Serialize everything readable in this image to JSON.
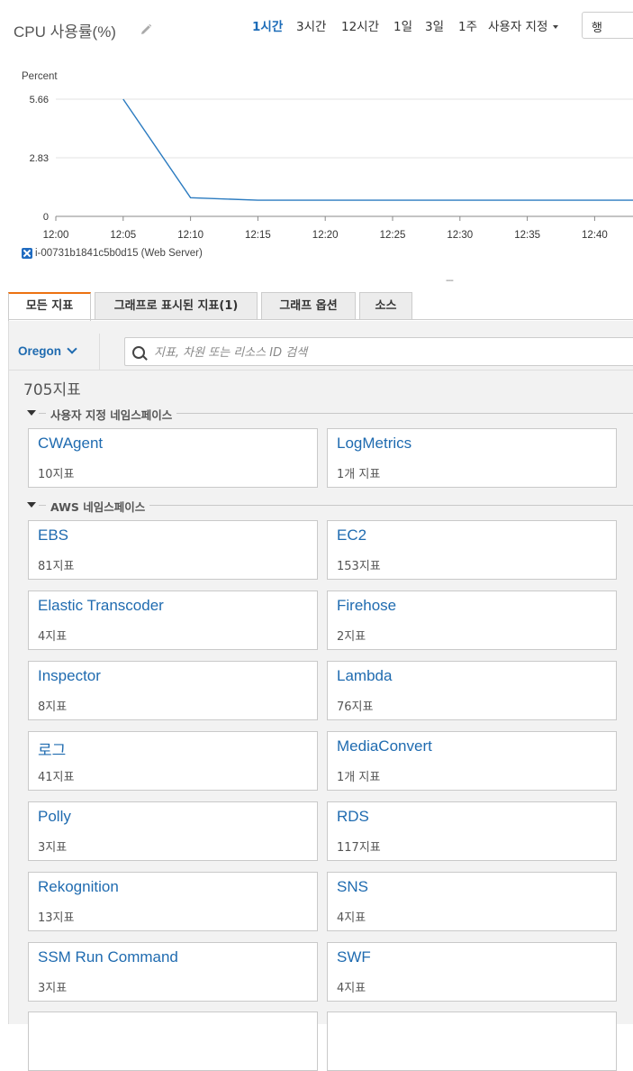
{
  "header": {
    "title": "CPU 사용률(%)",
    "ranges": [
      "1시간",
      "3시간",
      "12시간",
      "1일",
      "3일",
      "1주"
    ],
    "active_range": "1시간",
    "custom_label": "사용자 지정",
    "period_select_value": "행"
  },
  "chart_data": {
    "type": "line",
    "ylabel": "Percent",
    "y_ticks": [
      "0",
      "2.83",
      "5.66"
    ],
    "x_ticks": [
      "12:00",
      "12:05",
      "12:10",
      "12:15",
      "12:20",
      "12:25",
      "12:30",
      "12:35",
      "12:40"
    ],
    "series": [
      {
        "name": "i-00731b1841c5b0d15 (Web Server)",
        "x": [
          "12:05",
          "12:10",
          "12:15",
          "12:20",
          "12:25",
          "12:30",
          "12:35",
          "12:40",
          "12:43"
        ],
        "values": [
          5.66,
          0.9,
          0.78,
          0.78,
          0.78,
          0.78,
          0.78,
          0.78,
          0.78
        ]
      }
    ],
    "ylim": [
      0,
      5.66
    ],
    "color": "#2b7bc0"
  },
  "legend": {
    "label": "i-00731b1841c5b0d15 (Web Server)"
  },
  "tabs": [
    "모든 지표",
    "그래프로 표시된 지표(1)",
    "그래프 옵션",
    "소스"
  ],
  "browser": {
    "region": "Oregon",
    "search_placeholder": "지표, 차원 또는 리소스 ID 검색",
    "total_count": "705지표",
    "custom_namespace_header": "사용자 지정 네임스페이스",
    "aws_namespace_header": "AWS 네임스페이스",
    "custom_namespaces": [
      {
        "name": "CWAgent",
        "count": "10지표"
      },
      {
        "name": "LogMetrics",
        "count": "1개 지표"
      }
    ],
    "aws_namespaces": [
      {
        "name": "EBS",
        "count": "81지표"
      },
      {
        "name": "EC2",
        "count": "153지표"
      },
      {
        "name": "Elastic Transcoder",
        "count": "4지표"
      },
      {
        "name": "Firehose",
        "count": "2지표"
      },
      {
        "name": "Inspector",
        "count": "8지표"
      },
      {
        "name": "Lambda",
        "count": "76지표"
      },
      {
        "name": "로그",
        "count": "41지표"
      },
      {
        "name": "MediaConvert",
        "count": "1개 지표"
      },
      {
        "name": "Polly",
        "count": "3지표"
      },
      {
        "name": "RDS",
        "count": "117지표"
      },
      {
        "name": "Rekognition",
        "count": "13지표"
      },
      {
        "name": "SNS",
        "count": "4지표"
      },
      {
        "name": "SSM Run Command",
        "count": "3지표"
      },
      {
        "name": "SWF",
        "count": "4지표"
      }
    ]
  }
}
